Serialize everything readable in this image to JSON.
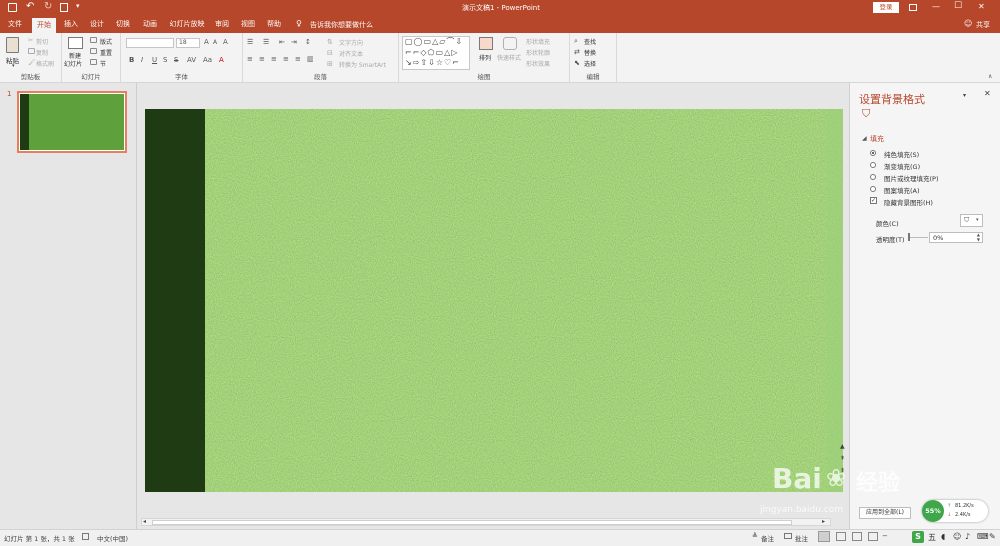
{
  "titlebar": {
    "title": "演示文稿1 - PowerPoint",
    "login": "登录",
    "restore_icon": "ribbon-display-icon",
    "min": "—",
    "max": "☐",
    "close": "✕"
  },
  "tabs": [
    "文件",
    "开始",
    "插入",
    "设计",
    "切换",
    "动画",
    "幻灯片放映",
    "审阅",
    "视图",
    "帮助"
  ],
  "active_tab": "开始",
  "tellme": "告诉我你想要做什么",
  "share": "共享",
  "ribbon": {
    "clipboard": {
      "paste": "粘贴",
      "cut": "剪切",
      "copy": "复制",
      "format_painter": "格式刷",
      "label": "剪贴板"
    },
    "slides": {
      "new_slide_1": "新建",
      "new_slide_2": "幻灯片",
      "layout": "版式",
      "reset": "重置",
      "section": "节",
      "label": "幻灯片"
    },
    "font": {
      "size": "18",
      "bold": "B",
      "italic": "I",
      "underline": "U",
      "strike": "S",
      "shadow": "S",
      "label": "字体"
    },
    "paragraph": {
      "text_direction": "文字方向",
      "align_text": "对齐文本",
      "smartart": "转换为 SmartArt",
      "label": "段落"
    },
    "drawing": {
      "arrange": "排列",
      "quick_styles": "快速样式",
      "shape_fill": "形状填充",
      "shape_outline": "形状轮廓",
      "shape_effects": "形状效果",
      "label": "绘图"
    },
    "editing": {
      "find": "查找",
      "replace": "替换",
      "select": "选择",
      "label": "编辑"
    }
  },
  "thumbnail": {
    "number": "1"
  },
  "pane": {
    "title": "设置背景格式",
    "section": "填充",
    "options": [
      "纯色填充(S)",
      "渐变填充(G)",
      "图片或纹理填充(P)",
      "图案填充(A)"
    ],
    "selected_option": 0,
    "hide_graphics": "隐藏背景图形(H)",
    "color_label": "颜色(C)",
    "transparency_label": "透明度(T)",
    "transparency_value": "0%",
    "apply_all": "应用到全部(L)"
  },
  "status": {
    "slide_info": "幻灯片 第 1 张，共 1 张",
    "language": "中文(中国)",
    "notes": "备注",
    "comments": "批注"
  },
  "speed": {
    "percent": "55%",
    "up": "81.2K/s",
    "down": "2.4K/s"
  },
  "watermark": {
    "brand": "Bai",
    "brand2": "经验",
    "url": "jingyan.baidu.com"
  },
  "colors": {
    "accent": "#b7472a",
    "slide_dark": "#1f3b13",
    "slide_green": "#5ea03c",
    "status_green": "#3fa64a"
  }
}
